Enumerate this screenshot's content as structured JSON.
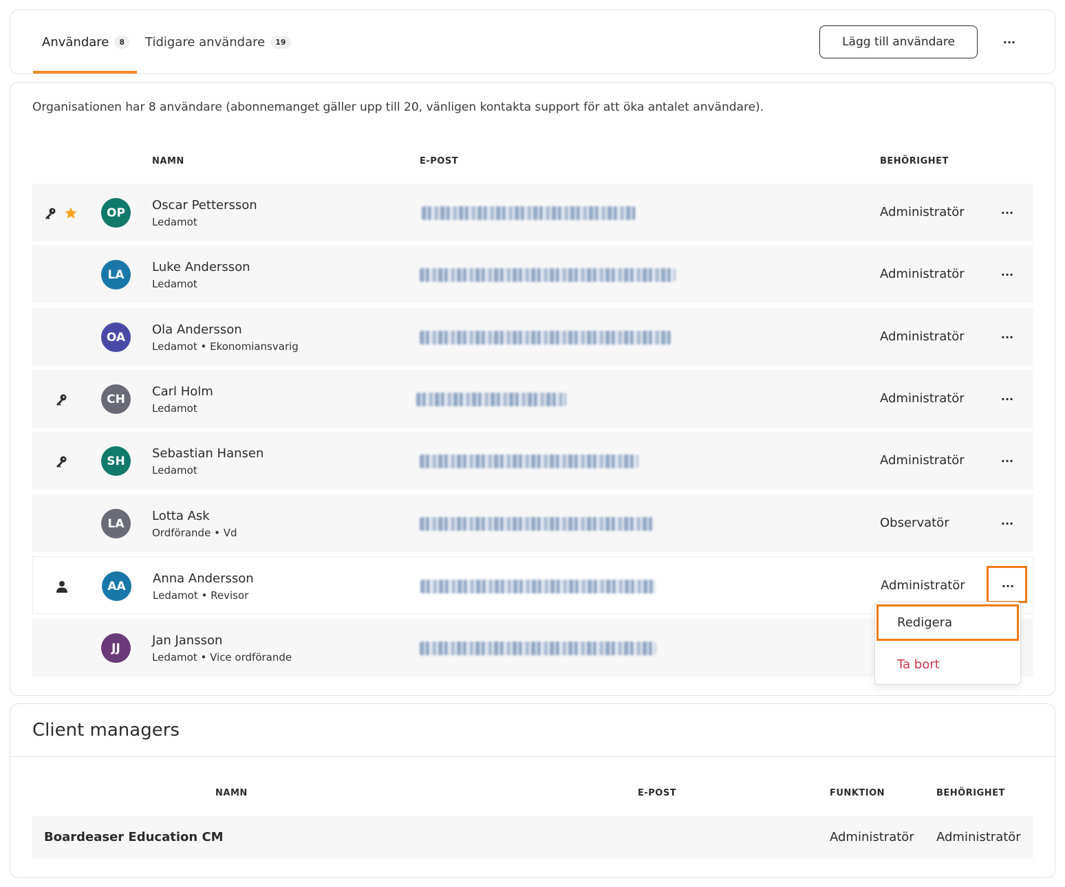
{
  "tabs": [
    {
      "label": "Användare",
      "count": "8"
    },
    {
      "label": "Tidigare användare",
      "count": "19"
    }
  ],
  "toolbar": {
    "add_user_label": "Lägg till användare",
    "more_label": "···"
  },
  "users_panel": {
    "info": "Organisationen har 8 användare (abonnemanget gäller upp till 20, vänligen kontakta support för att öka antalet användare).",
    "columns": {
      "name": "NAMN",
      "email": "E-POST",
      "permission": "BEHÖRIGHET"
    },
    "rows": [
      {
        "initials": "OP",
        "name": "Oscar Pettersson",
        "role": "Ledamot",
        "permission": "Administratör",
        "avatar_color": "#127a6a",
        "icons": [
          "key-icon",
          "star-icon"
        ]
      },
      {
        "initials": "LA",
        "name": "Luke Andersson",
        "role": "Ledamot",
        "permission": "Administratör",
        "avatar_color": "#1a78a8",
        "icons": []
      },
      {
        "initials": "OA",
        "name": "Ola Andersson",
        "role": "Ledamot • Ekonomiansvarig",
        "permission": "Administratör",
        "avatar_color": "#4a4aa6",
        "icons": []
      },
      {
        "initials": "CH",
        "name": "Carl Holm",
        "role": "Ledamot",
        "permission": "Administratör",
        "avatar_color": "#6b6b78",
        "icons": [
          "key-icon"
        ]
      },
      {
        "initials": "SH",
        "name": "Sebastian Hansen",
        "role": "Ledamot",
        "permission": "Administratör",
        "avatar_color": "#127a6a",
        "icons": [
          "key-icon"
        ]
      },
      {
        "initials": "LA",
        "name": "Lotta Ask",
        "role": "Ordförande • Vd",
        "permission": "Observatör",
        "avatar_color": "#6b6b78",
        "icons": []
      },
      {
        "initials": "AA",
        "name": "Anna Andersson",
        "role": "Ledamot • Revisor",
        "permission": "Administratör",
        "avatar_color": "#1a78a8",
        "icons": [
          "person-icon"
        ]
      },
      {
        "initials": "JJ",
        "name": "Jan Jansson",
        "role": "Ledamot • Vice ordförande",
        "permission": "",
        "avatar_color": "#6b3a78",
        "icons": []
      }
    ],
    "row_more_label": "···"
  },
  "context_menu": {
    "edit": "Redigera",
    "delete": "Ta bort"
  },
  "client_managers": {
    "title": "Client managers",
    "columns": {
      "name": "NAMN",
      "email": "E-POST",
      "function": "FUNKTION",
      "permission": "BEHÖRIGHET"
    },
    "rows": [
      {
        "name": "Boardeaser Education CM",
        "function": "Administratör",
        "permission": "Administratör"
      }
    ]
  },
  "colors": {
    "accent": "#f08a2c",
    "highlight": "#f07a14",
    "danger": "#c7364a",
    "row_bg": "#f7f7f7"
  }
}
